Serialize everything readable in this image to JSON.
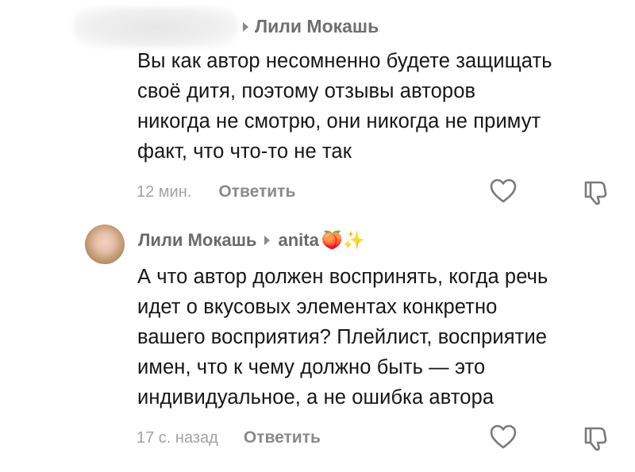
{
  "comment1": {
    "reply_to": "Лили Мокашь",
    "text_lines": [
      "Вы как автор несомненно будете защищать",
      "своё дитя, поэтому отзывы авторов",
      "никогда не смотрю, они никогда не примут",
      "факт, что что-то не так"
    ],
    "time": "12 мин.",
    "reply_label": "Ответить"
  },
  "comment2": {
    "author": "Лили Мокашь",
    "reply_to": "anita",
    "reply_to_emoji": "🍑✨",
    "text_lines": [
      "А что автор должен воспринять, когда речь",
      "идет о вкусовых элементах конкретно",
      "вашего восприятия? Плейлист, восприятие",
      "имен, что к чему должно быть — это",
      "индивидуальное, а не ошибка автора"
    ],
    "time": "17 с. назад",
    "reply_label": "Ответить"
  },
  "icons": {
    "like": "heart-outline-icon",
    "dislike": "thumbs-down-outline-icon",
    "reply_arrow": "caret-right-icon"
  },
  "colors": {
    "text": "#161616",
    "secondary": "#8a8a8a",
    "timestamp": "#a2a2a2"
  }
}
